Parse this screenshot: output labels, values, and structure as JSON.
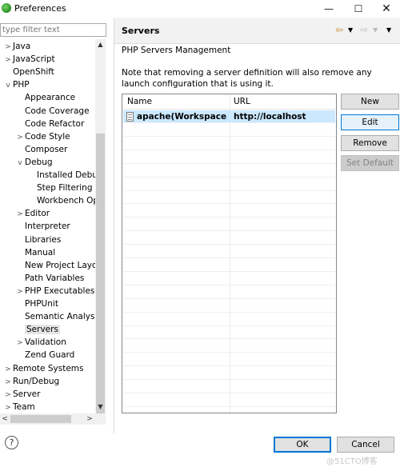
{
  "window": {
    "title": "Preferences",
    "minimize_glyph": "—",
    "maximize_glyph": "☐",
    "close_glyph": "✕"
  },
  "filter": {
    "placeholder": "type filter text"
  },
  "tree": [
    {
      "label": "Java",
      "twisty": ">",
      "indent": 0
    },
    {
      "label": "JavaScript",
      "twisty": ">",
      "indent": 0
    },
    {
      "label": "OpenShift",
      "twisty": "",
      "indent": 0
    },
    {
      "label": "PHP",
      "twisty": "v",
      "indent": 0
    },
    {
      "label": "Appearance",
      "twisty": "",
      "indent": 1
    },
    {
      "label": "Code Coverage",
      "twisty": "",
      "indent": 1
    },
    {
      "label": "Code Refactor",
      "twisty": "",
      "indent": 1
    },
    {
      "label": "Code Style",
      "twisty": ">",
      "indent": 1
    },
    {
      "label": "Composer",
      "twisty": "",
      "indent": 1
    },
    {
      "label": "Debug",
      "twisty": "v",
      "indent": 1
    },
    {
      "label": "Installed Debu",
      "twisty": "",
      "indent": 2
    },
    {
      "label": "Step Filtering",
      "twisty": "",
      "indent": 2
    },
    {
      "label": "Workbench Op",
      "twisty": "",
      "indent": 2
    },
    {
      "label": "Editor",
      "twisty": ">",
      "indent": 1
    },
    {
      "label": "Interpreter",
      "twisty": "",
      "indent": 1
    },
    {
      "label": "Libraries",
      "twisty": "",
      "indent": 1
    },
    {
      "label": "Manual",
      "twisty": "",
      "indent": 1
    },
    {
      "label": "New Project Layou",
      "twisty": "",
      "indent": 1
    },
    {
      "label": "Path Variables",
      "twisty": "",
      "indent": 1
    },
    {
      "label": "PHP Executables",
      "twisty": ">",
      "indent": 1
    },
    {
      "label": "PHPUnit",
      "twisty": "",
      "indent": 1
    },
    {
      "label": "Semantic Analysis",
      "twisty": "",
      "indent": 1
    },
    {
      "label": "Servers",
      "twisty": "",
      "indent": 1,
      "selected": true
    },
    {
      "label": "Validation",
      "twisty": ">",
      "indent": 1
    },
    {
      "label": "Zend Guard",
      "twisty": "",
      "indent": 1
    },
    {
      "label": "Remote Systems",
      "twisty": ">",
      "indent": 0
    },
    {
      "label": "Run/Debug",
      "twisty": ">",
      "indent": 0
    },
    {
      "label": "Server",
      "twisty": ">",
      "indent": 0
    },
    {
      "label": "Team",
      "twisty": ">",
      "indent": 0
    }
  ],
  "page": {
    "title": "Servers",
    "section_title": "PHP Servers Management",
    "note": "Note that removing a server definition will also remove any launch configuration that is using it."
  },
  "table": {
    "columns": [
      "Name",
      "URL"
    ],
    "rows": [
      {
        "name": "apache(Workspace D...",
        "url": "http://localhost",
        "selected": true
      }
    ]
  },
  "buttons": {
    "new": "New",
    "edit": "Edit",
    "remove": "Remove",
    "set_default": "Set Default",
    "ok": "OK",
    "cancel": "Cancel",
    "help": "?"
  },
  "watermark": "@51CTO博客",
  "colors": {
    "selection": "#cce8ff",
    "focus_border": "#0078d7",
    "header_bg": "#f2f2f2"
  }
}
